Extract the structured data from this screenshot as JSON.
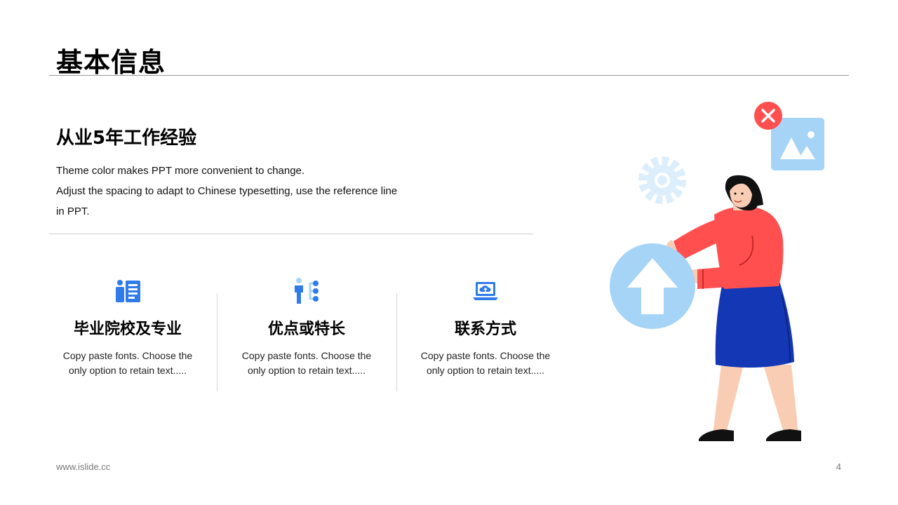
{
  "header": {
    "title": "基本信息"
  },
  "intro": {
    "subtitle": "从业5年工作经验",
    "lines": [
      "Theme color makes PPT more convenient to change.",
      "Adjust the spacing to adapt to Chinese typesetting, use the reference line",
      "in PPT."
    ]
  },
  "features": [
    {
      "icon": "id-card-icon",
      "title": "毕业院校及专业",
      "line1": "Copy paste fonts. Choose the",
      "line2": "only option to retain text....."
    },
    {
      "icon": "person-tree-icon",
      "title": "优点或特长",
      "line1": "Copy paste fonts. Choose the",
      "line2": "only option to retain text....."
    },
    {
      "icon": "laptop-cloud-icon",
      "title": "联系方式",
      "line1": "Copy paste fonts. Choose the",
      "line2": "only option to retain text....."
    }
  ],
  "footer": {
    "url": "www.islide.cc",
    "page": "4"
  },
  "colors": {
    "accent": "#2F7BEA",
    "light_blue": "#A6D4F7",
    "red": "#FF4F4F",
    "skirt": "#1437B5",
    "skin": "#F9CDB3"
  }
}
